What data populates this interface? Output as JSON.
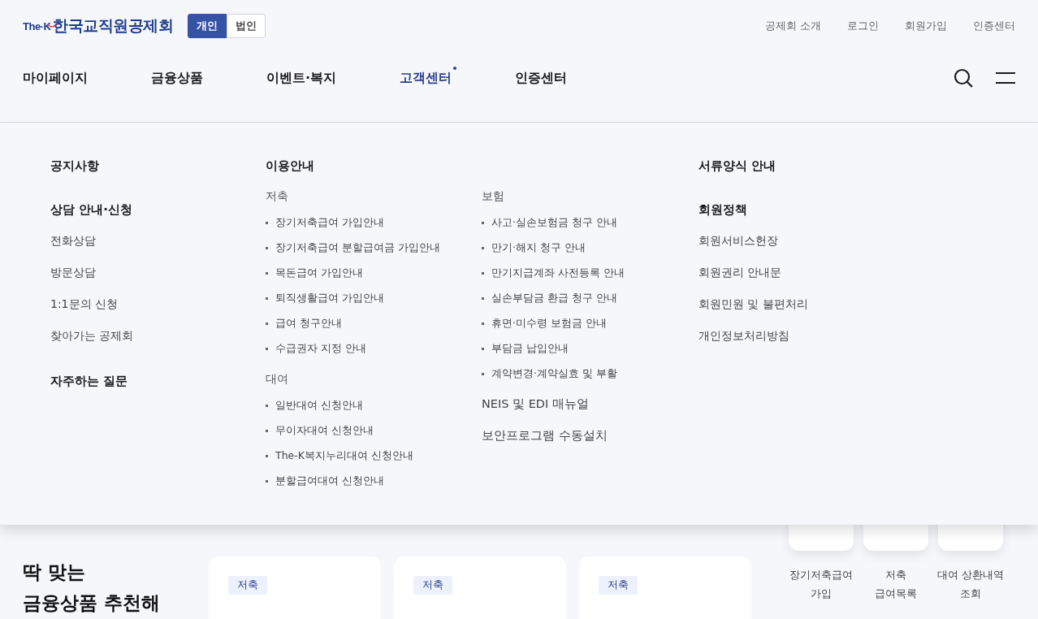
{
  "logo": {
    "prefix": "The·K",
    "name": "한국교직원공제회"
  },
  "member_tabs": [
    {
      "label": "개인",
      "selected": true
    },
    {
      "label": "법인",
      "selected": false
    }
  ],
  "utility_links": [
    "공제회 소개",
    "로그인",
    "회원가입",
    "인증센터"
  ],
  "main_nav": [
    {
      "label": "마이페이지",
      "selected": false
    },
    {
      "label": "금융상품",
      "selected": false
    },
    {
      "label": "이벤트·복지",
      "selected": false
    },
    {
      "label": "고객센터",
      "selected": true
    },
    {
      "label": "인증센터",
      "selected": false
    }
  ],
  "mega_menu": {
    "left": [
      {
        "title": "공지사항"
      },
      {
        "title": "상담 안내·신청",
        "links": [
          "전화상담",
          "방문상담",
          "1:1문의 신청",
          "찾아가는 공제회"
        ]
      },
      {
        "title": "자주하는 질문"
      }
    ],
    "usage": {
      "title": "이용안내",
      "columns": [
        {
          "groups": [
            {
              "title": "저축",
              "items": [
                "장기저축급여 가입안내",
                "장기저축급여 분할급여금 가입안내",
                "목돈급여 가입안내",
                "퇴직생활급여 가입안내",
                "급여 청구안내",
                "수급권자 지정 안내"
              ]
            },
            {
              "title": "대여",
              "items": [
                "일반대여 신청안내",
                "무이자대여 신청안내",
                "The-K복지누리대여 신청안내",
                "분할급여대여 신청안내"
              ]
            }
          ]
        },
        {
          "groups": [
            {
              "title": "보험",
              "items": [
                "사고·실손보험금 청구 안내",
                "만기·해지 청구 안내",
                "만기지급계좌 사전등록 안내",
                "실손부담금 환급 청구 안내",
                "휴면·미수령 보험금 안내",
                "부담금 납입안내",
                "계약변경·계약실효 및 부활"
              ]
            }
          ],
          "links": [
            "NEIS 및 EDI 매뉴얼",
            "보안프로그램 수동설치"
          ]
        }
      ]
    },
    "right": [
      {
        "title": "서류양식 안내"
      },
      {
        "title": "회원정책",
        "links": [
          "회원서비스헌장",
          "회원권리 안내문",
          "회원민원 및 불편처리",
          "개인정보처리방침"
        ]
      }
    ]
  },
  "recommend": {
    "heading": "딱 맞는\n금융상품 추천해",
    "cards": [
      {
        "tag": "저축"
      },
      {
        "tag": "저축"
      },
      {
        "tag": "저축"
      }
    ]
  },
  "quick_links": [
    {
      "label": "장기저축급여\n가입"
    },
    {
      "label": "저축\n급여목록"
    },
    {
      "label": "대여 상환내역\n조회"
    }
  ]
}
